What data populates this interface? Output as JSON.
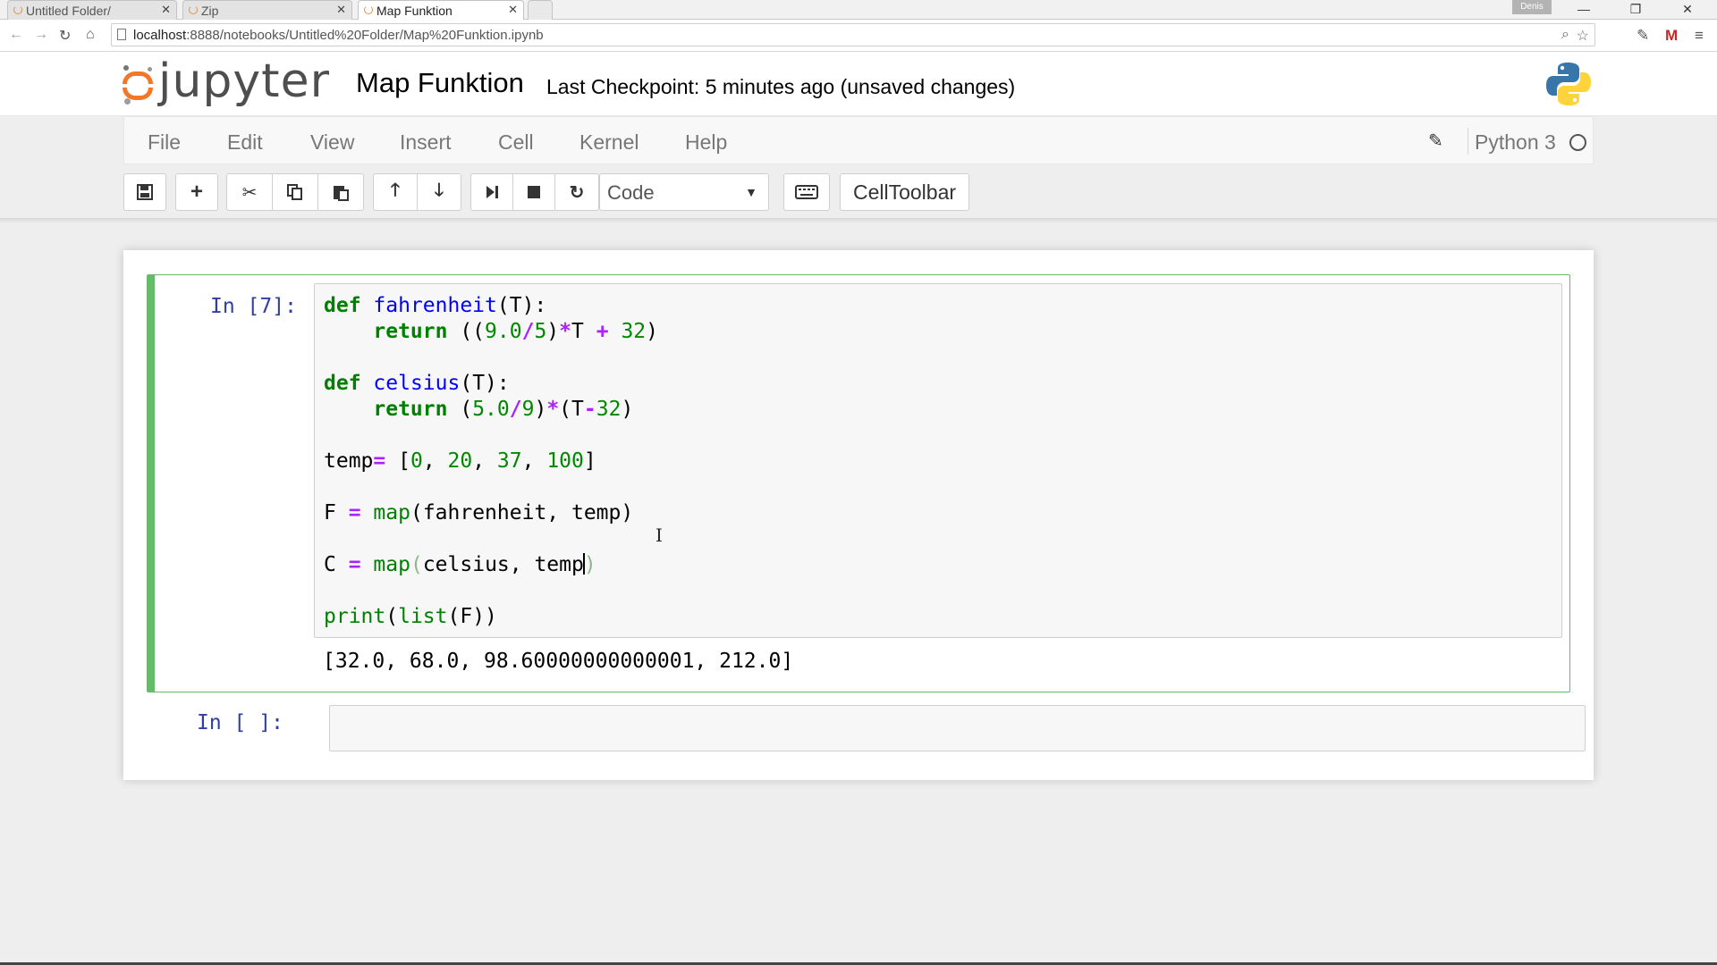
{
  "browser": {
    "tabs": [
      {
        "label": "Untitled Folder/",
        "active": false
      },
      {
        "label": "Zip",
        "active": false
      },
      {
        "label": "Map Funktion",
        "active": true
      }
    ],
    "user_badge": "Denis",
    "url": {
      "host": "localhost",
      "rest": ":8888/notebooks/Untitled%20Folder/Map%20Funktion.ipynb"
    }
  },
  "header": {
    "logo_text": "jupyter",
    "notebook_name": "Map Funktion",
    "checkpoint": "Last Checkpoint: 5 minutes ago (unsaved changes)"
  },
  "menubar": {
    "items": [
      "File",
      "Edit",
      "View",
      "Insert",
      "Cell",
      "Kernel",
      "Help"
    ],
    "kernel": "Python 3"
  },
  "toolbar": {
    "cell_type": "Code",
    "celltoolbar": "CellToolbar"
  },
  "cells": [
    {
      "prompt": "In [7]:",
      "source": [
        "def fahrenheit(T):",
        "    return ((9.0/5)*T + 32)",
        "",
        "def celsius(T):",
        "    return (5.0/9)*(T-32)",
        "",
        "temp= [0, 20, 37, 100]",
        "",
        "F = map(fahrenheit, temp)",
        "",
        "C = map(celsius, temp)",
        "",
        "print(list(F))"
      ],
      "output": "[32.0, 68.0, 98.60000000000001, 212.0]"
    },
    {
      "prompt": "In [ ]:",
      "source": []
    }
  ],
  "colors": {
    "selected_cell_border": "#66bb6a",
    "prompt": "#303f9f",
    "jupyter_orange": "#f37726"
  }
}
